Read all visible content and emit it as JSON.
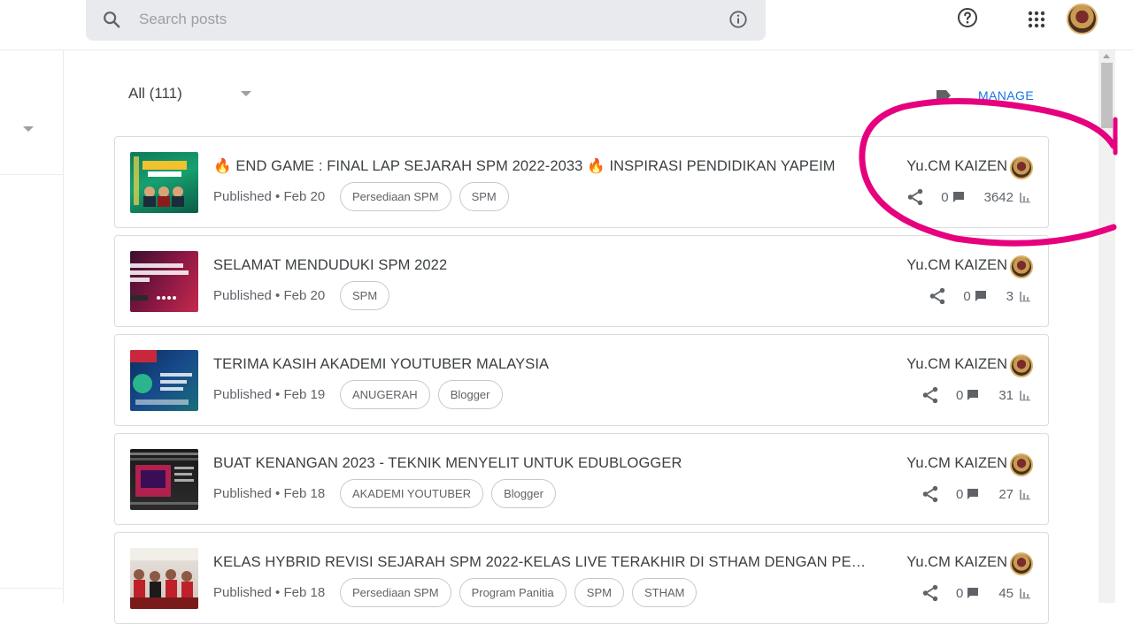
{
  "search": {
    "placeholder": "Search posts",
    "value": ""
  },
  "header": {
    "icons": [
      "search-icon",
      "info-icon",
      "help-icon",
      "apps-grid-icon",
      "account-avatar"
    ]
  },
  "filter": {
    "label": "All (111)"
  },
  "manage": {
    "label": "MANAGE"
  },
  "colors": {
    "accent": "#1a73e8",
    "annotation": "#e6007e",
    "border": "#dadce0"
  },
  "posts": [
    {
      "title": "🔥 END GAME : FINAL LAP SEJARAH SPM 2022-2033 🔥 INSPIRASI PENDIDIKAN YAPEIM",
      "status": "Published • Feb 20",
      "labels": [
        "Persediaan SPM",
        "SPM"
      ],
      "author": "Yu.CM KAIZEN",
      "comments": "0",
      "views": "3642"
    },
    {
      "title": "SELAMAT MENDUDUKI SPM 2022",
      "status": "Published • Feb 20",
      "labels": [
        "SPM"
      ],
      "author": "Yu.CM KAIZEN",
      "comments": "0",
      "views": "3"
    },
    {
      "title": "TERIMA KASIH AKADEMI YOUTUBER MALAYSIA",
      "status": "Published • Feb 19",
      "labels": [
        "ANUGERAH",
        "Blogger"
      ],
      "author": "Yu.CM KAIZEN",
      "comments": "0",
      "views": "31"
    },
    {
      "title": "BUAT KENANGAN 2023 - TEKNIK MENYELIT UNTUK EDUBLOGGER",
      "status": "Published • Feb 18",
      "labels": [
        "AKADEMI YOUTUBER",
        "Blogger"
      ],
      "author": "Yu.CM KAIZEN",
      "comments": "0",
      "views": "27"
    },
    {
      "title": "KELAS HYBRID REVISI SEJARAH SPM 2022-KELAS LIVE TERAKHIR DI STHAM DENGAN PEL...",
      "status": "Published • Feb 18",
      "labels": [
        "Persediaan SPM",
        "Program Panitia",
        "SPM",
        "STHAM"
      ],
      "author": "Yu.CM KAIZEN",
      "comments": "0",
      "views": "45"
    }
  ]
}
